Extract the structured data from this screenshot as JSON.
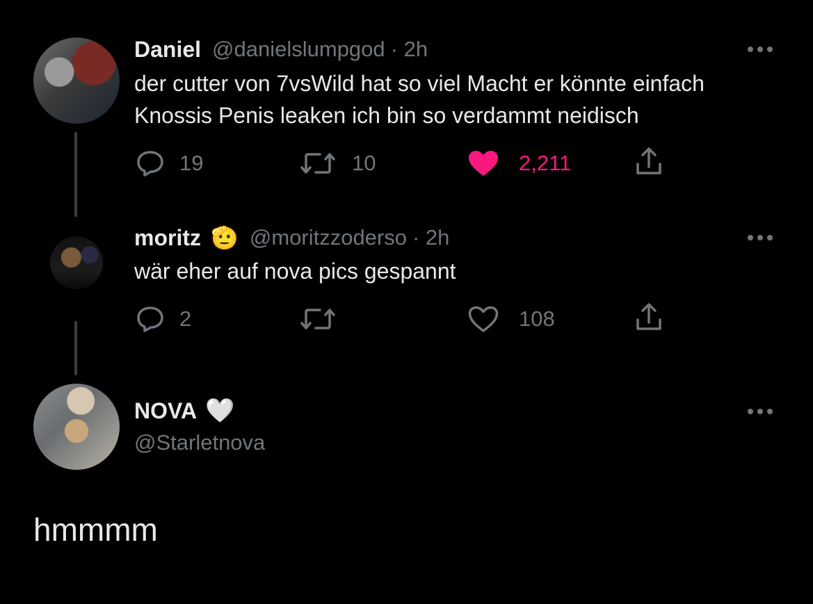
{
  "tweets": [
    {
      "name": "Daniel",
      "handle": "@danielslumpgod",
      "time": "· 2h",
      "text_line1": "der cutter von 7vsWild hat so viel Macht er könnte einfach",
      "text_line2": "Knossis Penis leaken ich bin so verdammt neidisch",
      "replies": "19",
      "retweets": "10",
      "likes": "2,211",
      "liked": true,
      "avatar_icon": "user-avatar-photo"
    },
    {
      "name": "moritz",
      "name_emoji": "🫡",
      "handle": "@moritzzoderso",
      "time": "· 2h",
      "text_line1": "wär eher auf nova pics gespannt",
      "replies": "2",
      "retweets": "",
      "likes": "108",
      "liked": false,
      "avatar_icon": "user-avatar-photo"
    }
  ],
  "main_tweet": {
    "name": "NOVA",
    "name_emoji": "🤍",
    "handle": "@Starletnova",
    "text": "hmmmm",
    "avatar_icon": "user-avatar-photo"
  },
  "colors": {
    "background": "#000000",
    "text": "#e7e9ea",
    "muted": "#71767b",
    "like": "#f91880"
  }
}
